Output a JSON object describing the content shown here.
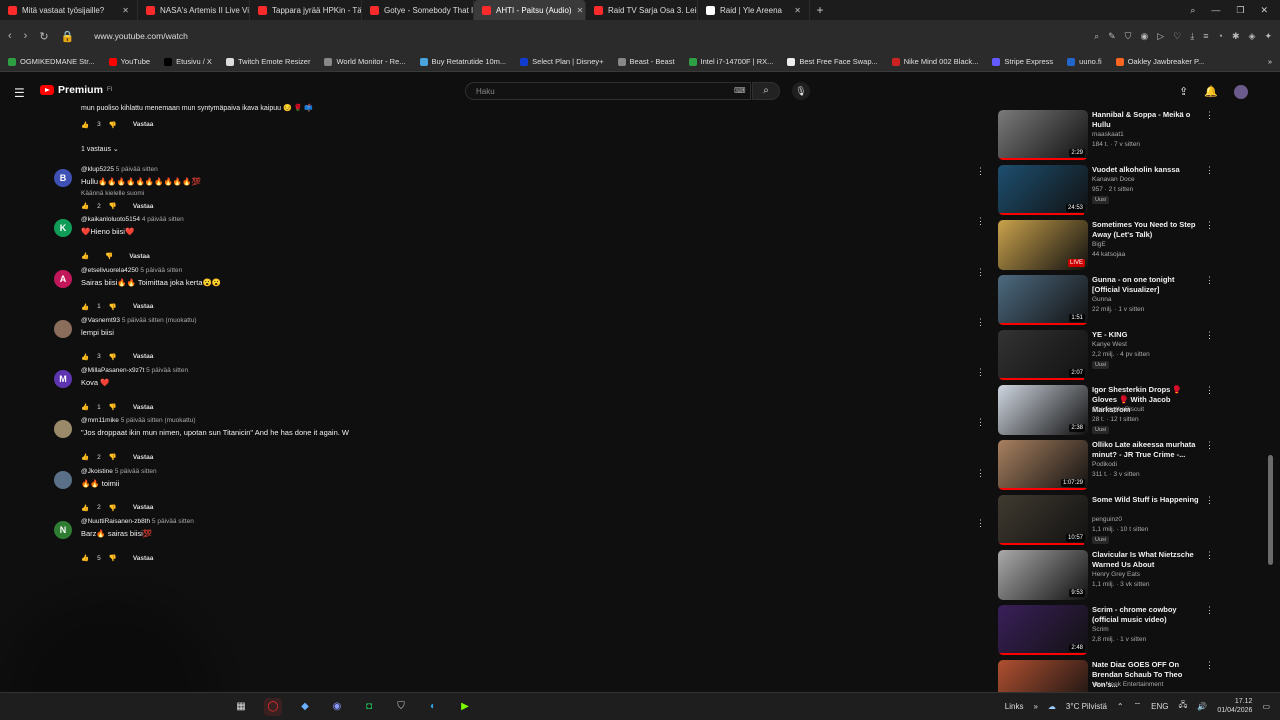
{
  "browser": {
    "tabs": [
      {
        "title": "Mitä vastaat työsijaille?",
        "active": false
      },
      {
        "title": "NASA's Artemis II Live Vi",
        "active": false
      },
      {
        "title": "Tappara jyrää HPKin - Tä",
        "active": false
      },
      {
        "title": "Gotye - Somebody That I",
        "active": false
      },
      {
        "title": "AHTI - Paitsu (Audio)",
        "active": true
      },
      {
        "title": "Raid TV Sarja Osa 3. Leim",
        "active": false
      },
      {
        "title": "Raid | Yle Areena",
        "active": false
      }
    ],
    "url": "www.youtube.com/watch",
    "bookmarks": [
      {
        "label": "OGMIKEDMANE Str...",
        "color": "#2ea043"
      },
      {
        "label": "YouTube",
        "color": "#ff0000"
      },
      {
        "label": "Etusivu / X",
        "color": "#000000"
      },
      {
        "label": "Twitch Emote Resizer",
        "color": "#dddddd"
      },
      {
        "label": "World Monitor - Re...",
        "color": "#888888"
      },
      {
        "label": "Buy Retatrutide 10m...",
        "color": "#4aa3df"
      },
      {
        "label": "Select Plan | Disney+",
        "color": "#113ccf"
      },
      {
        "label": "Beast - Beast",
        "color": "#888888"
      },
      {
        "label": "Intel i7-14700F | RX...",
        "color": "#2ea043"
      },
      {
        "label": "Best Free Face Swap...",
        "color": "#eeeeee"
      },
      {
        "label": "Nike Mind 002 Black...",
        "color": "#cc2222"
      },
      {
        "label": "Stripe Express",
        "color": "#635bff"
      },
      {
        "label": "uuno.fi",
        "color": "#2266cc"
      },
      {
        "label": "Oakley Jawbreaker P...",
        "color": "#ff6622"
      }
    ]
  },
  "youtube": {
    "logo_text": "Premium",
    "logo_sup": "FI",
    "search_placeholder": "Haku"
  },
  "first_comment": {
    "text": "mun puoliso kihlattu menemaan mun syntymäpaiva ikava kaipuu 😔 🌹 📫",
    "likes": "3",
    "reply": "Vastaa",
    "replies_toggle": "1 vastaus"
  },
  "comments": [
    {
      "user": "@klup5225",
      "ago": "5 päivää sitten",
      "text": "Hullu🔥🔥🔥🔥🔥🔥🔥🔥🔥🔥💯",
      "text2": "Käännä kielelle suomi",
      "likes": "2",
      "reply": "Vastaa",
      "avatar_letter": "B",
      "avatar_color": "#3f51b5"
    },
    {
      "user": "@kaikanloluoto5154",
      "ago": "4 päivää sitten",
      "text": "❤️Hieno biisi❤️",
      "text2": "",
      "likes": "",
      "reply": "Vastaa",
      "avatar_letter": "K",
      "avatar_color": "#0f9d58"
    },
    {
      "user": "@etselivuorela4250",
      "ago": "5 päivää sitten",
      "text": "Sairas biisi🔥🔥 Toimittaa joka kerta😮😮",
      "text2": "",
      "likes": "1",
      "reply": "Vastaa",
      "avatar_letter": "A",
      "avatar_color": "#c2185b"
    },
    {
      "user": "@Vasnemt93",
      "ago": "5 päivää sitten (muokattu)",
      "text": "lempi biisi",
      "text2": "",
      "likes": "3",
      "reply": "Vastaa",
      "avatar_letter": "",
      "avatar_color": "#8a6d5a"
    },
    {
      "user": "@MillaPasanen-x9z7t",
      "ago": "5 päivää sitten",
      "text": "Kova ❤️",
      "text2": "",
      "likes": "1",
      "reply": "Vastaa",
      "avatar_letter": "M",
      "avatar_color": "#5e35b1"
    },
    {
      "user": "@mm11mike",
      "ago": "5 päivää sitten (muokattu)",
      "text": "\"Jos droppaat ikin mun nimen, upotan sun Titanicin\" And he has done it again. W",
      "text2": "",
      "likes": "2",
      "reply": "Vastaa",
      "avatar_letter": "",
      "avatar_color": "#9a8a6a"
    },
    {
      "user": "@Jkoistine",
      "ago": "5 päivää sitten",
      "text": "🔥🔥 toimii",
      "text2": "",
      "likes": "2",
      "reply": "Vastaa",
      "avatar_letter": "",
      "avatar_color": "#5a7088"
    },
    {
      "user": "@NuuttiRaisanen-zb8th",
      "ago": "5 päivää sitten",
      "text": "Barz🔥 sairas biisi💯",
      "text2": "",
      "likes": "5",
      "reply": "Vastaa",
      "avatar_letter": "N",
      "avatar_color": "#2e7d32"
    }
  ],
  "sidebar_videos": [
    {
      "title": "Hannibal & Soppa - Meikä o Hullu",
      "channel": "maaskaat1",
      "stats": "184 t. · 7 v sitten",
      "badge": "",
      "duration": "2:29",
      "thumb": "#7a7a7a"
    },
    {
      "title": "Vuodet alkoholin kanssa",
      "channel": "Kanavan Doce",
      "stats": "957 · 2 t sitten",
      "badge": "Uusi",
      "duration": "24:53",
      "thumb": "#1d4f70"
    },
    {
      "title": "Sometimes You Need to Step Away (Let's Talk)",
      "channel": "BigE",
      "stats": "44 katsojaa",
      "badge": "",
      "duration": "LIVE",
      "thumb": "#caa24c"
    },
    {
      "title": "Gunna - on one tonight [Official Visualizer]",
      "channel": "Gunna",
      "stats": "22 milj. · 1 v sitten",
      "badge": "",
      "duration": "1:51",
      "thumb": "#4d6a80"
    },
    {
      "title": "YE - KING",
      "channel": "Kanye West",
      "stats": "2,2 milj. · 4 pv sitten",
      "badge": "Uusi",
      "duration": "2:07",
      "thumb": "#333333"
    },
    {
      "title": "Igor Shesterkin Drops 🥊 Gloves 🥊 With Jacob Markstrom",
      "channel": "ChasingtheBiscuit",
      "stats": "28 t. · 12 t sitten",
      "badge": "Uusi",
      "duration": "2:38",
      "thumb": "#cfd6e0"
    },
    {
      "title": "Olliko Late aikeessa murhata minut? - JR True Crime -...",
      "channel": "Podikodi",
      "stats": "311 t. · 3 v sitten",
      "badge": "",
      "duration": "1:07:29",
      "thumb": "#a88060"
    },
    {
      "title": "Some Wild Stuff is Happening",
      "channel": "penguinz0",
      "stats": "1,1 milj. · 10 t sitten",
      "badge": "Uusi",
      "duration": "10:57",
      "thumb": "#403a30"
    },
    {
      "title": "Clavicular Is What Nietzsche Warned Us About",
      "channel": "Henry Grey Eats",
      "stats": "1,1 milj. · 3 vk sitten",
      "badge": "",
      "duration": "9:53",
      "thumb": "#aaaaaa"
    },
    {
      "title": "Scrim - chrome cowboy (official music video)",
      "channel": "Scrim",
      "stats": "2,8 milj. · 1 v sitten",
      "badge": "",
      "duration": "2:48",
      "thumb": "#3a1f5a"
    },
    {
      "title": "Nate Diaz GOES OFF On Brendan Schaub To Theo Von's...",
      "channel": "Yew Neek Entertainment",
      "stats": "",
      "badge": "",
      "duration": "",
      "thumb": "#b05030"
    }
  ],
  "taskbar": {
    "links_label": "Links",
    "weather": "3°C Pilvistä",
    "lang": "ENG",
    "time": "17.12",
    "date": "01/04/2026"
  }
}
